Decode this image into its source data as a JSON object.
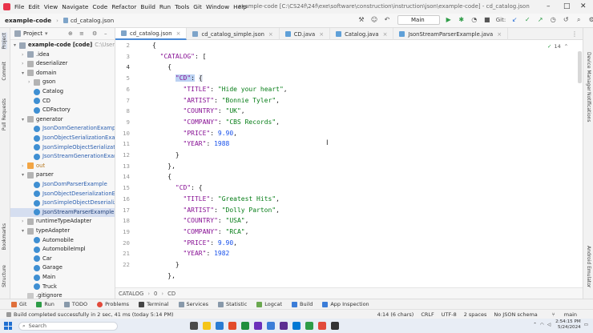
{
  "menubar": {
    "items": [
      "File",
      "Edit",
      "View",
      "Navigate",
      "Code",
      "Refactor",
      "Build",
      "Run",
      "Tools",
      "Git",
      "Window",
      "Help"
    ],
    "title_path": "example-code [C:\\CS24f\\24f\\exe\\software\\construction\\instruction\\json\\example-code] - cd_catalog.json"
  },
  "navbar": {
    "project": "example-code",
    "file": "cd_catalog.json",
    "run_config": "Main",
    "git_label": "Git:"
  },
  "project_panel": {
    "title": "Project",
    "items": [
      {
        "label": "example-code [code]",
        "extra": "C:\\Users\\...",
        "type": "folder"
      },
      {
        "label": ".idea",
        "type": "folder"
      },
      {
        "label": "deserializer",
        "type": "pkg"
      },
      {
        "label": "domain",
        "type": "pkg"
      },
      {
        "label": "gson",
        "type": "pkg"
      },
      {
        "label": "Catalog",
        "type": "cls"
      },
      {
        "label": "CD",
        "type": "cls"
      },
      {
        "label": "CDFactory",
        "type": "cls"
      },
      {
        "label": "generator",
        "type": "pkg"
      },
      {
        "label": "JsonDomGenerationExample",
        "type": "cls"
      },
      {
        "label": "JsonObjectSerializationExample",
        "type": "cls"
      },
      {
        "label": "JsonSimpleObjectSerialization",
        "type": "cls"
      },
      {
        "label": "JsonStreamGenerationExample",
        "type": "cls"
      },
      {
        "label": "out",
        "type": "ofolder"
      },
      {
        "label": "parser",
        "type": "pkg"
      },
      {
        "label": "JsonDomParserExample",
        "type": "cls"
      },
      {
        "label": "JsonObjectDeserializationExample",
        "type": "cls"
      },
      {
        "label": "JsonSimpleObjectDeserialization",
        "type": "cls"
      },
      {
        "label": "JsonStreamParserExample",
        "type": "cls"
      },
      {
        "label": "runtimeTypeAdapter",
        "type": "pkg"
      },
      {
        "label": "typeAdapter",
        "type": "pkg"
      },
      {
        "label": "Automobile",
        "type": "cls"
      },
      {
        "label": "AutomobileImpl",
        "type": "cls"
      },
      {
        "label": "Car",
        "type": "cls"
      },
      {
        "label": "Garage",
        "type": "cls"
      },
      {
        "label": "Main",
        "type": "cls"
      },
      {
        "label": "Truck",
        "type": "cls"
      },
      {
        "label": ".gitignore",
        "type": "file"
      }
    ]
  },
  "tabs": [
    "cd_catalog.json",
    "cd_catalog_simple.json",
    "CD.java",
    "Catalog.java",
    "JsonStreamParserExample.java"
  ],
  "editor": {
    "line_numbers": [
      "2",
      "3",
      "4",
      "5",
      "6",
      "7",
      "8",
      "9",
      "10",
      "11",
      "12",
      "13",
      "14",
      "15",
      "16",
      "17",
      "18",
      "19",
      "20",
      "21",
      "22"
    ],
    "inspections": "14",
    "lines": [
      "{",
      "  \"CATALOG\": [",
      "    {",
      "      \"CD\": {",
      "        \"TITLE\": \"Hide your heart\",",
      "        \"ARTIST\": \"Bonnie Tyler\",",
      "        \"COUNTRY\": \"UK\",",
      "        \"COMPANY\": \"CBS Records\",",
      "        \"PRICE\": 9.90,",
      "        \"YEAR\": 1988",
      "      }",
      "    },",
      "    {",
      "      \"CD\": {",
      "        \"TITLE\": \"Greatest Hits\",",
      "        \"ARTIST\": \"Dolly Parton\",",
      "        \"COUNTRY\": \"USA\",",
      "        \"COMPANY\": \"RCA\",",
      "        \"PRICE\": 9.90,",
      "        \"YEAR\": 1982",
      "      }",
      "    },"
    ]
  },
  "breadcrumb": [
    "CATALOG",
    "0",
    "CD"
  ],
  "tool_windows": [
    "Git",
    "Run",
    "TODO",
    "Problems",
    "Terminal",
    "Services",
    "Statistic",
    "Logcat",
    "Build",
    "App Inspection"
  ],
  "status": {
    "message": "Build completed successfully in 2 sec, 41 ms (today 5:14 PM)",
    "position": "4:14 (6 chars)",
    "line_sep": "CRLF",
    "encoding": "UTF-8",
    "indent": "2 spaces",
    "schema": "No JSON schema",
    "branch": "main"
  },
  "right_strip": [
    "Device Manager",
    "Notifications",
    "Android Emulator"
  ],
  "left_strip": [
    "Project",
    "Commit",
    "Pull Requests",
    "Bookmarks",
    "Structure"
  ],
  "taskbar": {
    "search": "Search",
    "time": "2:54:15 PM",
    "date": "5/24/2024"
  }
}
